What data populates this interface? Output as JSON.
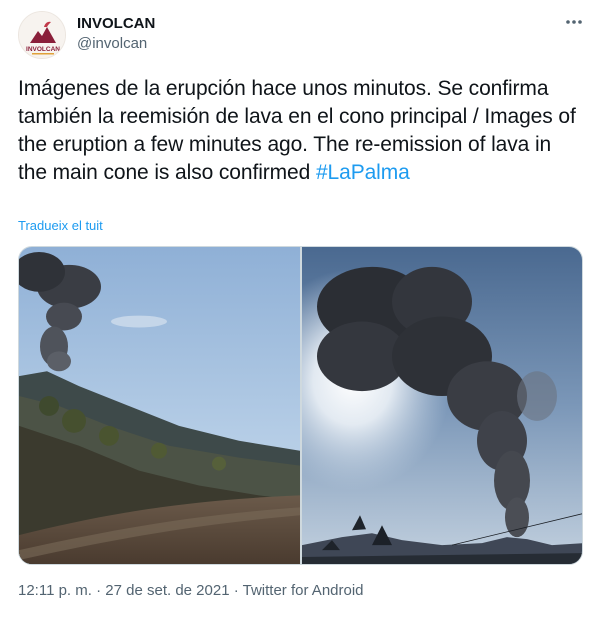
{
  "author": {
    "name": "INVOLCAN",
    "handle": "@involcan",
    "avatar_icon": "involcan-logo-icon",
    "avatar_logo_text": "INVOLCAN"
  },
  "tweet": {
    "text": "Imágenes de la erupción hace unos minutos. Se confirma también la reemisión de lava en el cono principal / Images of the eruption a few minutes ago. The re-emission of lava in the main cone is also confirmed ",
    "hashtag": "#LaPalma",
    "translate_label": "Tradueix el tuit"
  },
  "media": {
    "photos": [
      {
        "subject": "volcano-smoke-left-photo"
      },
      {
        "subject": "volcano-smoke-right-photo"
      }
    ]
  },
  "meta": {
    "time": "12:11 p. m.",
    "separator": " · ",
    "date": "27 de set. de 2021",
    "source": "Twitter for Android"
  },
  "colors": {
    "accent": "#1d9bf0",
    "text": "#0f1419",
    "secondary": "#536471"
  }
}
